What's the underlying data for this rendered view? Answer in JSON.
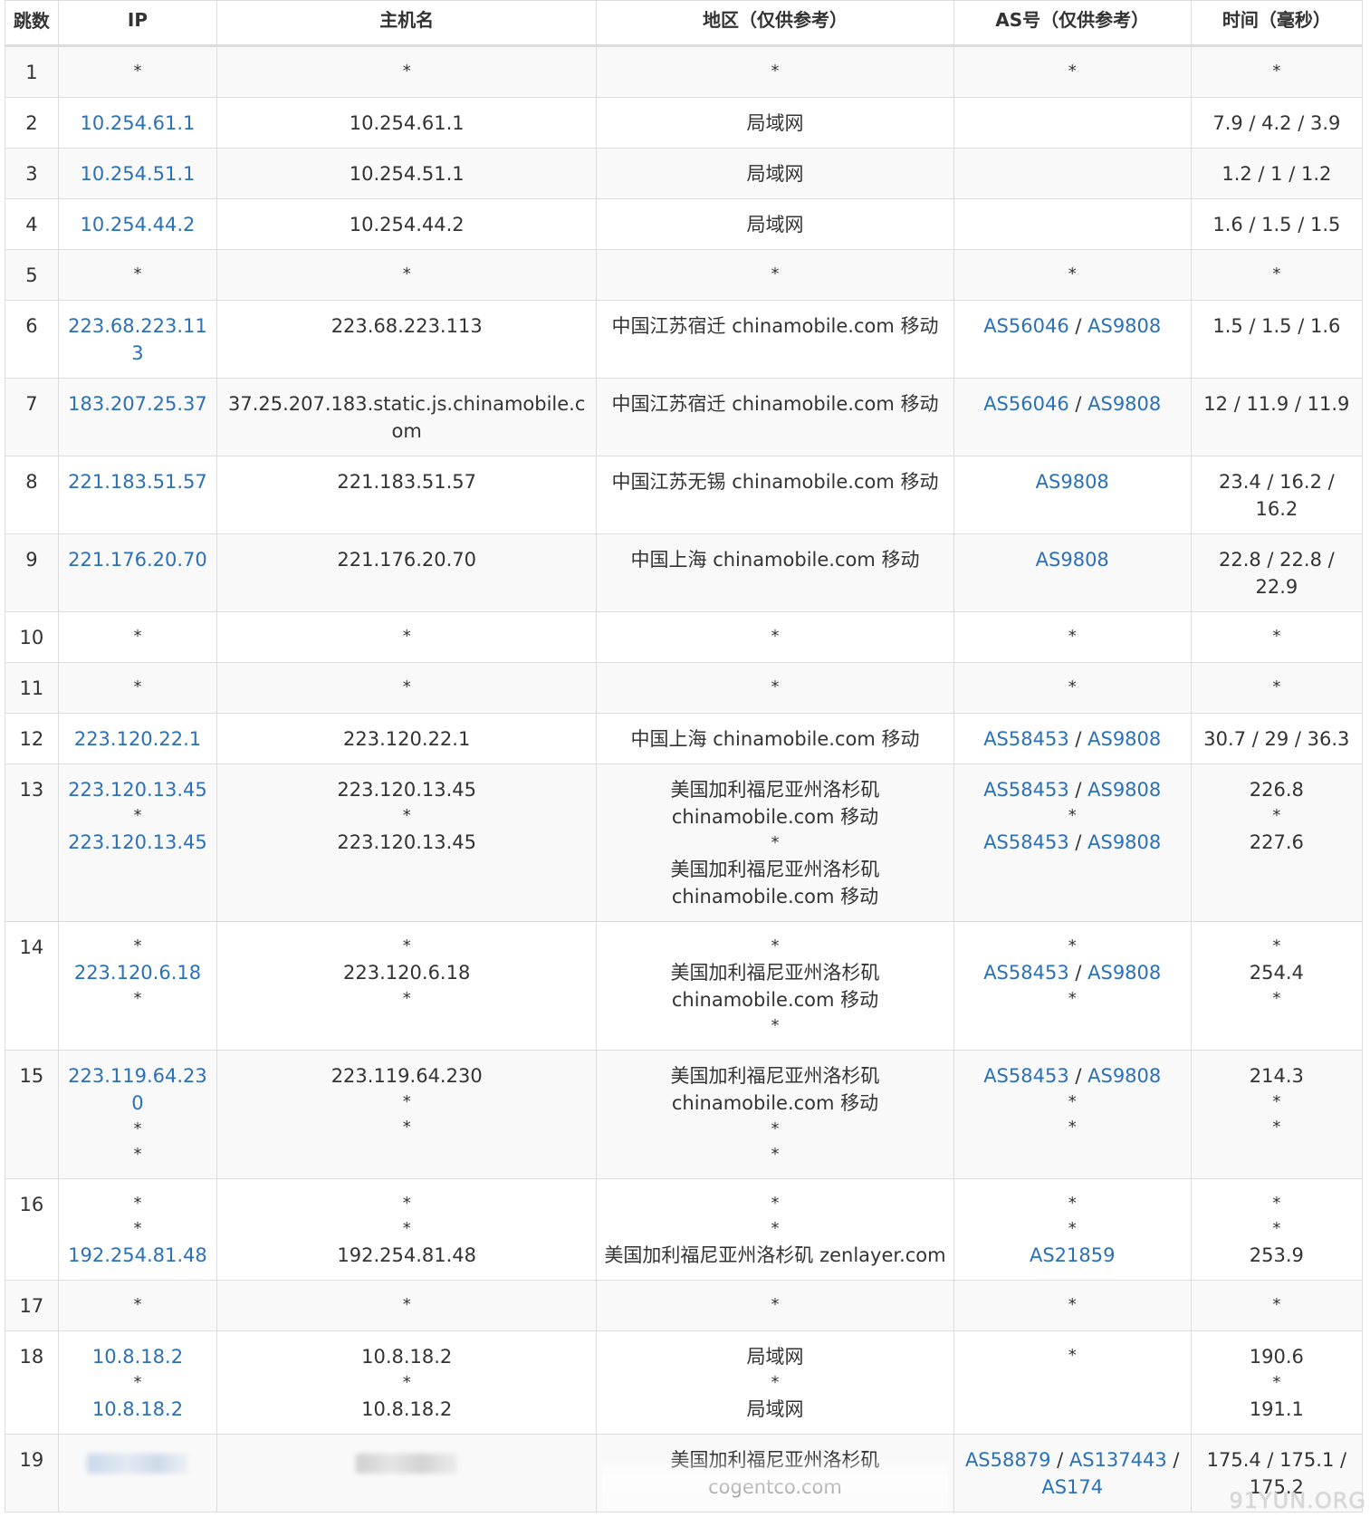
{
  "headers": {
    "hop": "跳数",
    "ip": "IP",
    "host": "主机名",
    "region": "地区（仅供参考）",
    "asn": "AS号（仅供参考）",
    "time": "时间（毫秒）"
  },
  "rows": [
    {
      "hop": "1",
      "ip": [
        "*"
      ],
      "host": [
        "*"
      ],
      "region": [
        "*"
      ],
      "asn": [
        [
          "*"
        ]
      ],
      "time": [
        "*"
      ]
    },
    {
      "hop": "2",
      "ip": [
        "10.254.61.1"
      ],
      "host": [
        "10.254.61.1"
      ],
      "region": [
        "局域网"
      ],
      "asn": [],
      "time": [
        "7.9 / 4.2 / 3.9"
      ]
    },
    {
      "hop": "3",
      "ip": [
        "10.254.51.1"
      ],
      "host": [
        "10.254.51.1"
      ],
      "region": [
        "局域网"
      ],
      "asn": [],
      "time": [
        "1.2 / 1 / 1.2"
      ]
    },
    {
      "hop": "4",
      "ip": [
        "10.254.44.2"
      ],
      "host": [
        "10.254.44.2"
      ],
      "region": [
        "局域网"
      ],
      "asn": [],
      "time": [
        "1.6 / 1.5 / 1.5"
      ]
    },
    {
      "hop": "5",
      "ip": [
        "*"
      ],
      "host": [
        "*"
      ],
      "region": [
        "*"
      ],
      "asn": [
        [
          "*"
        ]
      ],
      "time": [
        "*"
      ]
    },
    {
      "hop": "6",
      "ip": [
        "223.68.223.113"
      ],
      "host": [
        "223.68.223.113"
      ],
      "region": [
        "中国江苏宿迁 chinamobile.com 移动"
      ],
      "asn": [
        [
          "AS56046",
          "AS9808"
        ]
      ],
      "time": [
        "1.5 / 1.5 / 1.6"
      ]
    },
    {
      "hop": "7",
      "ip": [
        "183.207.25.37"
      ],
      "host": [
        "37.25.207.183.static.js.chinamobile.com"
      ],
      "region": [
        "中国江苏宿迁 chinamobile.com 移动"
      ],
      "asn": [
        [
          "AS56046",
          "AS9808"
        ]
      ],
      "time": [
        "12 / 11.9 / 11.9"
      ]
    },
    {
      "hop": "8",
      "ip": [
        "221.183.51.57"
      ],
      "host": [
        "221.183.51.57"
      ],
      "region": [
        "中国江苏无锡 chinamobile.com 移动"
      ],
      "asn": [
        [
          "AS9808"
        ]
      ],
      "time": [
        "23.4 / 16.2 / 16.2"
      ]
    },
    {
      "hop": "9",
      "ip": [
        "221.176.20.70"
      ],
      "host": [
        "221.176.20.70"
      ],
      "region": [
        "中国上海 chinamobile.com 移动"
      ],
      "asn": [
        [
          "AS9808"
        ]
      ],
      "time": [
        "22.8 / 22.8 / 22.9"
      ]
    },
    {
      "hop": "10",
      "ip": [
        "*"
      ],
      "host": [
        "*"
      ],
      "region": [
        "*"
      ],
      "asn": [
        [
          "*"
        ]
      ],
      "time": [
        "*"
      ]
    },
    {
      "hop": "11",
      "ip": [
        "*"
      ],
      "host": [
        "*"
      ],
      "region": [
        "*"
      ],
      "asn": [
        [
          "*"
        ]
      ],
      "time": [
        "*"
      ]
    },
    {
      "hop": "12",
      "ip": [
        "223.120.22.1"
      ],
      "host": [
        "223.120.22.1"
      ],
      "region": [
        "中国上海 chinamobile.com 移动"
      ],
      "asn": [
        [
          "AS58453",
          "AS9808"
        ]
      ],
      "time": [
        "30.7 / 29 / 36.3"
      ]
    },
    {
      "hop": "13",
      "ip": [
        "223.120.13.45",
        "*",
        "223.120.13.45"
      ],
      "host": [
        "223.120.13.45",
        "*",
        "223.120.13.45"
      ],
      "region": [
        "美国加利福尼亚州洛杉矶 chinamobile.com 移动",
        "*",
        "美国加利福尼亚州洛杉矶 chinamobile.com 移动"
      ],
      "asn": [
        [
          "AS58453",
          "AS9808"
        ],
        [
          "*"
        ],
        [
          "AS58453",
          "AS9808"
        ]
      ],
      "time": [
        "226.8",
        "*",
        "227.6"
      ]
    },
    {
      "hop": "14",
      "ip": [
        "*",
        "223.120.6.18",
        "*"
      ],
      "host": [
        "*",
        "223.120.6.18",
        "*"
      ],
      "region": [
        "*",
        "美国加利福尼亚州洛杉矶 chinamobile.com 移动",
        "*"
      ],
      "asn": [
        [
          "*"
        ],
        [
          "AS58453",
          "AS9808"
        ],
        [
          "*"
        ]
      ],
      "time": [
        "*",
        "254.4",
        "*"
      ]
    },
    {
      "hop": "15",
      "ip": [
        "223.119.64.230",
        "*",
        "*"
      ],
      "host": [
        "223.119.64.230",
        "*",
        "*"
      ],
      "region": [
        "美国加利福尼亚州洛杉矶 chinamobile.com 移动",
        "*",
        "*"
      ],
      "asn": [
        [
          "AS58453",
          "AS9808"
        ],
        [
          "*"
        ],
        [
          "*"
        ]
      ],
      "time": [
        "214.3",
        "*",
        "*"
      ]
    },
    {
      "hop": "16",
      "ip": [
        "*",
        "*",
        "192.254.81.48"
      ],
      "host": [
        "*",
        "*",
        "192.254.81.48"
      ],
      "region": [
        "*",
        "*",
        "美国加利福尼亚州洛杉矶 zenlayer.com"
      ],
      "asn": [
        [
          "*"
        ],
        [
          "*"
        ],
        [
          "AS21859"
        ]
      ],
      "time": [
        "*",
        "*",
        "253.9"
      ]
    },
    {
      "hop": "17",
      "ip": [
        "*"
      ],
      "host": [
        "*"
      ],
      "region": [
        "*"
      ],
      "asn": [
        [
          "*"
        ]
      ],
      "time": [
        "*"
      ]
    },
    {
      "hop": "18",
      "ip": [
        "10.8.18.2",
        "*",
        "10.8.18.2"
      ],
      "host": [
        "10.8.18.2",
        "*",
        "10.8.18.2"
      ],
      "region": [
        "局域网",
        "*",
        "局域网"
      ],
      "asn": [
        [
          "*"
        ]
      ],
      "time": [
        "190.6",
        "*",
        "191.1"
      ]
    },
    {
      "hop": "19",
      "ip": [
        "__blur__"
      ],
      "host": [
        "__blurgrey__"
      ],
      "region": [
        "__fade__美国加利福尼亚州洛杉矶 cogentco.com"
      ],
      "asn": [
        [
          "AS58879",
          "AS137443",
          "AS174"
        ]
      ],
      "time": [
        "175.4 / 175.1 / 175.2"
      ]
    }
  ],
  "watermark": "91YUN.ORG"
}
